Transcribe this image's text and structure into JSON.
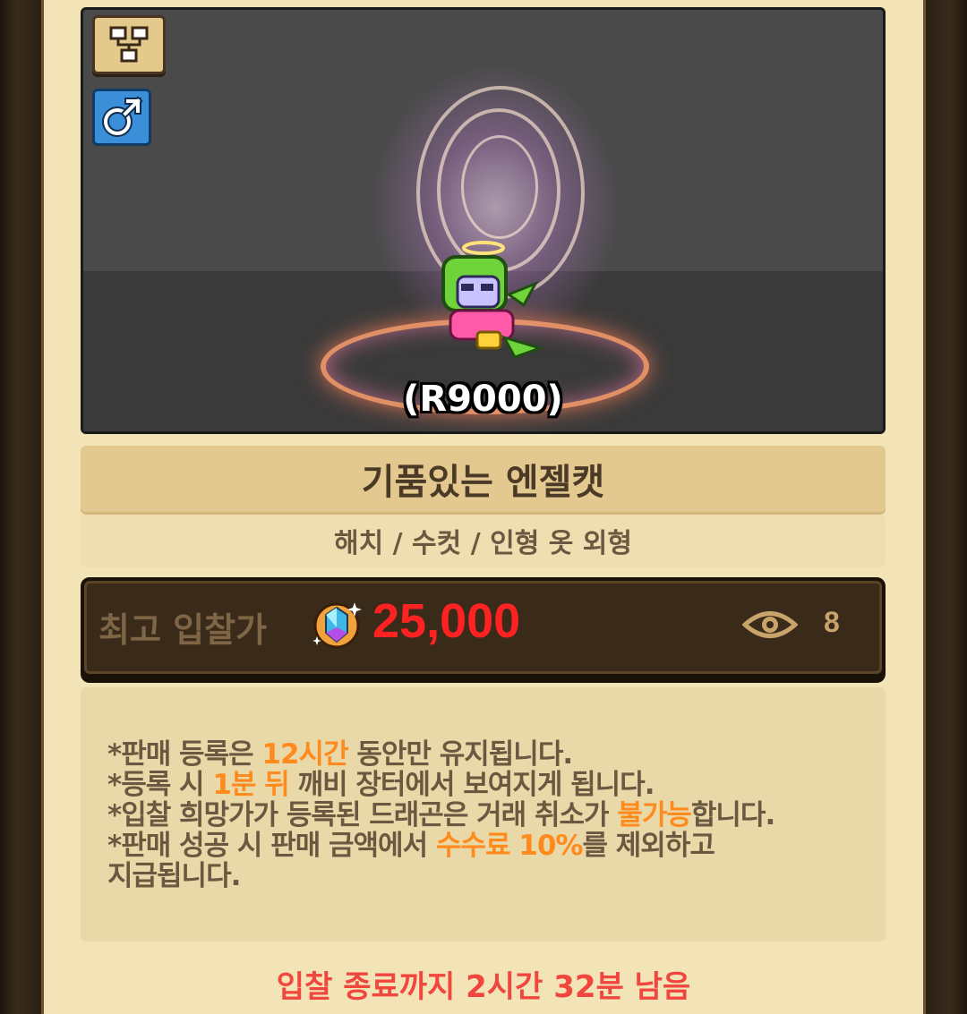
{
  "preview": {
    "pet_type_icon": "structure-icon",
    "gender_icon": "male-icon",
    "id_label": "(R9000)"
  },
  "item": {
    "name": "기품있는 엔젤캣",
    "traits": "해치 / 수컷 / 인형 옷 외형"
  },
  "bid": {
    "label": "최고 입찰가",
    "currency_icon": "gem-icon",
    "amount": "25,000",
    "view_icon": "eye-icon",
    "views": "8"
  },
  "notice": {
    "line1_pre": "*판매 등록은 ",
    "line1_hl": "12시간",
    "line1_post": " 동안만 유지됩니다.",
    "line2_pre": "*등록 시 ",
    "line2_hl": "1분 뒤",
    "line2_post": " 깨비 장터에서 보여지게 됩니다.",
    "line3_pre": "*입찰 희망가가 등록된 드래곤은 거래 취소가 ",
    "line3_hl": "불가능",
    "line3_post": "합니다.",
    "line4_pre": "*판매 성공 시 판매 금액에서 ",
    "line4_hl": "수수료 10%",
    "line4_post": "를 제외하고",
    "line5": "지급됩니다."
  },
  "footer": {
    "time_left": "입찰 종료까지 2시간 32분 남음"
  },
  "colors": {
    "panel_bg": "#f3e4b8",
    "bid_amount": "#ff2222",
    "highlight": "#ff8a1e",
    "time_left": "#f0463e"
  }
}
